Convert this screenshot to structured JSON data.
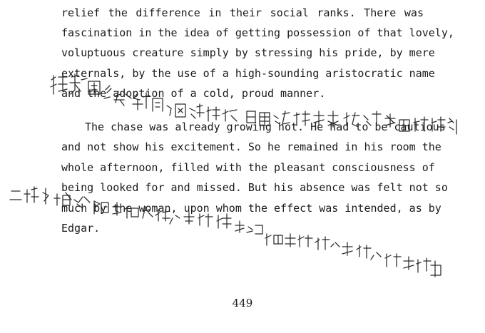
{
  "paragraph_1": {
    "lines": [
      "relief the difference in their social ranks. There was",
      "fascination in the idea of getting possession of that lovely,",
      "voluptuous creature simply by stressing his pride, by mere",
      "externals, by the use of a high-sounding aristocratic name",
      "and the adoption of a cold, proud manner."
    ]
  },
  "paragraph_2": {
    "lines": [
      "The chase was already growing hot. He had to be cautious",
      "and not show his excitement. So he remained in his room the",
      "whole afternoon, filled with the pleasant consciousness of",
      "being looked for and missed. But his absence was felt not so",
      "much by the woman, upon whom the effect was intended, as by",
      "Edgar."
    ]
  },
  "page_number": "449",
  "handwriting": {
    "note_1": "据美国《防务新闻》网站报道，日前，该行业大事记关注美国防部",
    "note_2": "二峰长城隔断阴阳石梁，雷炸深渊在盘期顶，同崖青峰渗碧苍，翠影荫霞",
    "ink_color": "#2a2a2a"
  }
}
